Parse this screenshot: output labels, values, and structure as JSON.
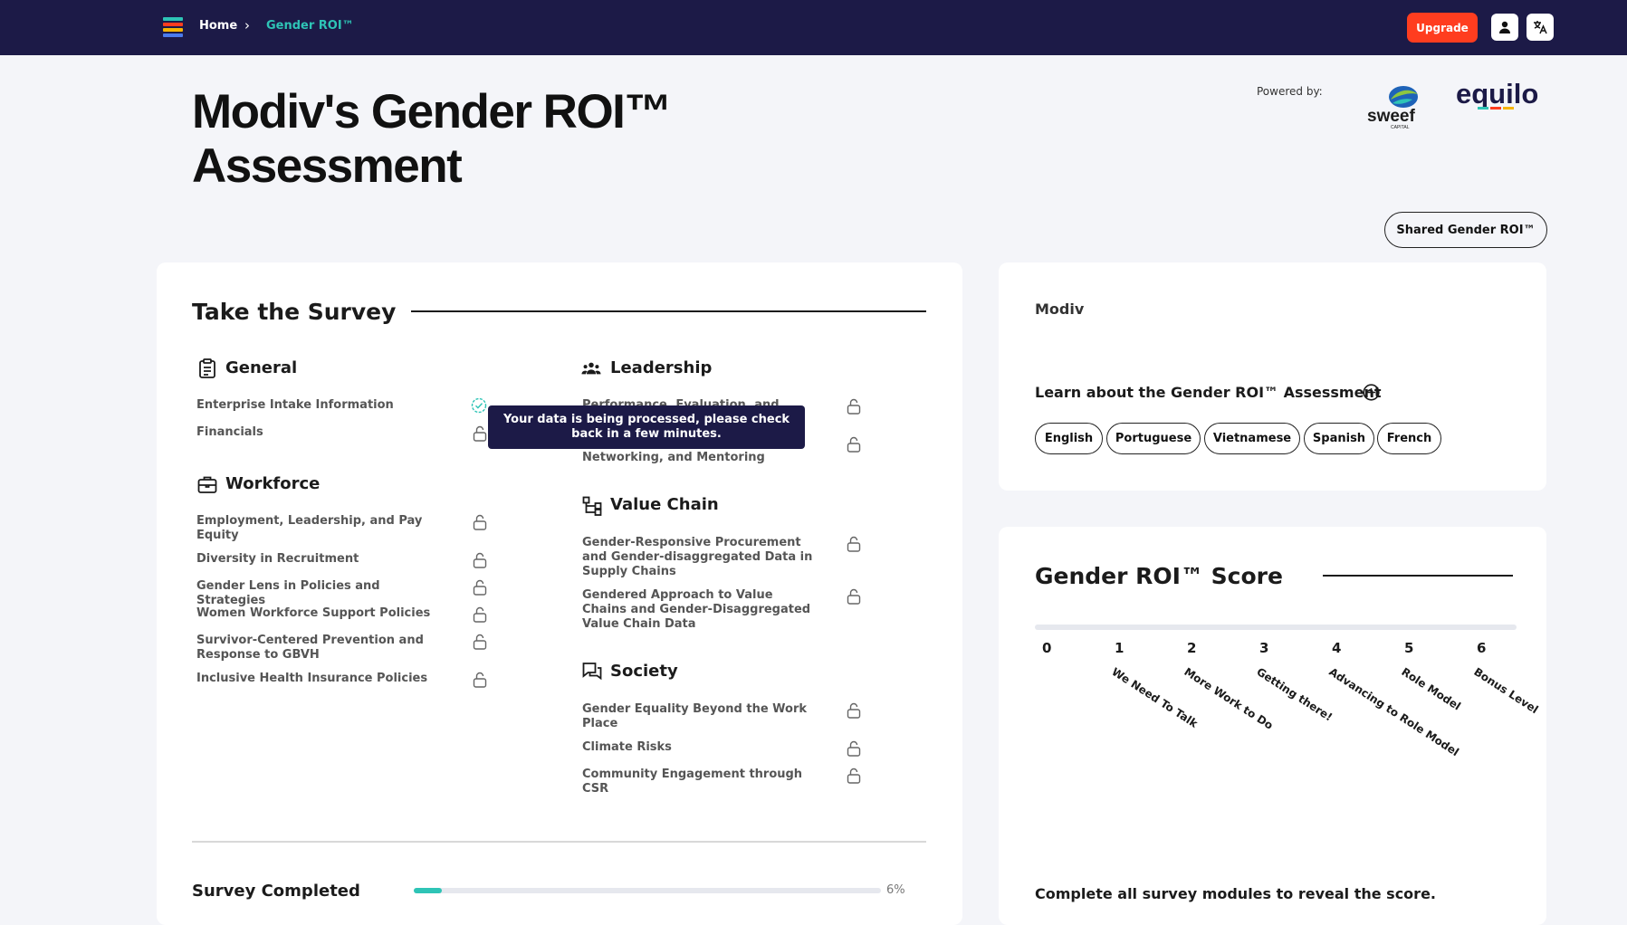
{
  "nav": {
    "home": "Home",
    "separator": "›",
    "current": "Gender ROI™",
    "upgrade": "Upgrade",
    "icons": [
      "user-icon",
      "translate-icon"
    ]
  },
  "header": {
    "title": "Modiv's Gender ROI™ Assessment",
    "powered_by": "Powered by:",
    "partner_logos": [
      "sweef capital",
      "equilo"
    ],
    "shared_button": "Shared Gender ROI™"
  },
  "survey": {
    "title": "Take the Survey",
    "categories": [
      {
        "name": "General",
        "icon": "clipboard-icon",
        "items": [
          {
            "label": "Enterprise Intake Information",
            "status": "completed"
          },
          {
            "label": "Financials",
            "status": "locked"
          }
        ]
      },
      {
        "name": "Workforce",
        "icon": "briefcase-icon",
        "items": [
          {
            "label": "Employment, Leadership, and Pay Equity",
            "status": "locked"
          },
          {
            "label": "Diversity in Recruitment",
            "status": "locked"
          },
          {
            "label": "Gender Lens in Policies and Strategies",
            "status": "locked"
          },
          {
            "label": "Women Workforce Support Policies",
            "status": "locked"
          },
          {
            "label": "Survivor-Centered Prevention and Response to GBVH",
            "status": "locked"
          },
          {
            "label": "Inclusive Health Insurance Policies",
            "status": "locked"
          }
        ]
      },
      {
        "name": "Leadership",
        "icon": "people-icon",
        "items": [
          {
            "label": "Performance, Evaluation, and",
            "status": "locked"
          },
          {
            "label": "Networking, and Mentoring",
            "status": "locked"
          }
        ]
      },
      {
        "name": "Value Chain",
        "icon": "hierarchy-icon",
        "items": [
          {
            "label": "Gender-Responsive Procurement and Gender-disaggregated Data in Supply Chains",
            "status": "locked"
          },
          {
            "label": "Gendered Approach to Value Chains and Gender-Disaggregated Value Chain Data",
            "status": "locked"
          }
        ]
      },
      {
        "name": "Society",
        "icon": "chat-icon",
        "items": [
          {
            "label": "Gender Equality Beyond the Work Place",
            "status": "locked"
          },
          {
            "label": "Climate Risks",
            "status": "locked"
          },
          {
            "label": "Community Engagement through CSR",
            "status": "locked"
          }
        ]
      }
    ],
    "tooltip": "Your data is being processed, please check back in a few minutes.",
    "completed_label": "Survey Completed",
    "progress_percent": 6,
    "progress_text": "6%"
  },
  "company": {
    "name": "Modiv",
    "learn_title": "Learn about the Gender ROI™ Assessment",
    "languages": [
      "English",
      "Portuguese",
      "Vietnamese",
      "Spanish",
      "French"
    ]
  },
  "score": {
    "title": "Gender ROI™ Score",
    "levels": [
      {
        "value": "0",
        "label": ""
      },
      {
        "value": "1",
        "label": "We Need To Talk"
      },
      {
        "value": "2",
        "label": "More Work to Do"
      },
      {
        "value": "3",
        "label": "Getting there!"
      },
      {
        "value": "4",
        "label": "Advancing to Role Model"
      },
      {
        "value": "5",
        "label": "Role Model"
      },
      {
        "value": "6",
        "label": "Bonus Level"
      }
    ],
    "note": "Complete all survey modules to reveal the score."
  },
  "colors": {
    "navy": "#1c1a47",
    "accent": "#2ec4b6",
    "upgrade": "#ff3d1f"
  }
}
